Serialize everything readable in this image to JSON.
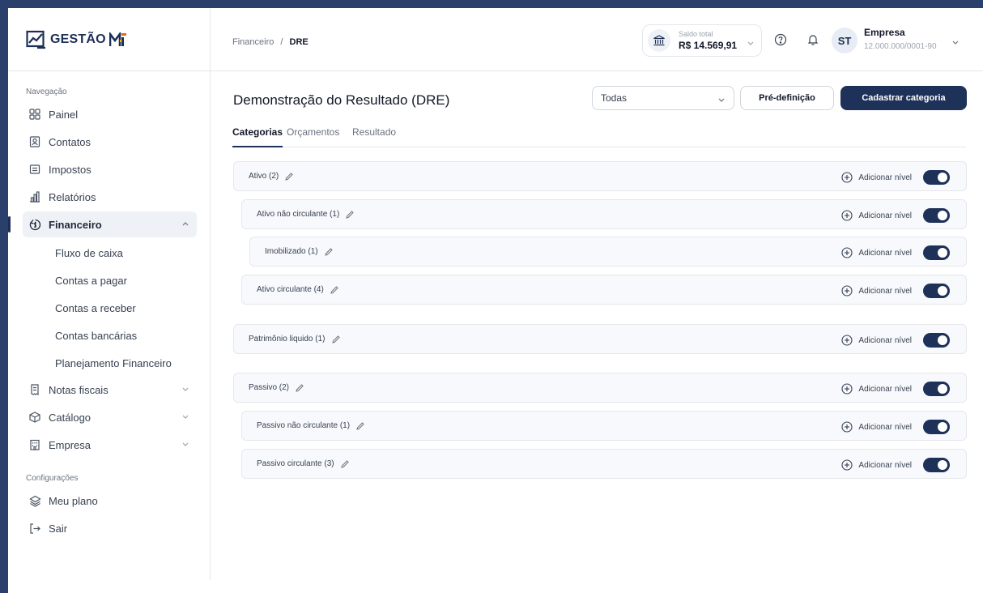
{
  "brand": {
    "name": "GESTÃO",
    "mark": "MEI"
  },
  "sidebar": {
    "nav_section_label": "Navegação",
    "items": [
      {
        "label": "Painel",
        "icon": "grid-icon"
      },
      {
        "label": "Contatos",
        "icon": "contact-card-icon"
      },
      {
        "label": "Impostos",
        "icon": "receipt-icon"
      },
      {
        "label": "Relatórios",
        "icon": "bar-chart-icon"
      },
      {
        "label": "Financeiro",
        "icon": "finance-icon",
        "active": true,
        "expanded": true
      },
      {
        "label": "Notas fiscais",
        "icon": "invoice-icon"
      },
      {
        "label": "Catálogo",
        "icon": "box-icon"
      },
      {
        "label": "Empresa",
        "icon": "building-icon"
      }
    ],
    "financeiro_sub": [
      "Fluxo de caixa",
      "Contas a pagar",
      "Contas a receber",
      "Contas bancárias",
      "Planejamento Financeiro"
    ],
    "config_label": "Configurações",
    "config_items": [
      {
        "label": "Meu plano",
        "icon": "layers-icon"
      },
      {
        "label": "Sair",
        "icon": "logout-icon"
      }
    ]
  },
  "header": {
    "breadcrumb": {
      "parent": "Financeiro",
      "separator": "/",
      "current": "DRE"
    },
    "balance": {
      "label": "Saldo total",
      "value": "R$ 14.569,91"
    },
    "avatar_initials": "ST",
    "company": {
      "name": "Empresa",
      "doc": "12.000.000/0001-90"
    }
  },
  "main": {
    "title": "Demonstração do Resultado (DRE)",
    "filter_value": "Todas",
    "predef_label": "Pré-definição",
    "primary_label": "Cadastrar categoria",
    "tabs": [
      "Categorias",
      "Orçamentos",
      "Resultado"
    ],
    "active_tab": "Categorias",
    "add_level_label": "Adicionar nível",
    "rows": [
      {
        "label": "Ativo (2)",
        "level": 0,
        "enabled": true
      },
      {
        "label": "Ativo não circulante (1)",
        "level": 1,
        "enabled": true
      },
      {
        "label": "Imobilizado (1)",
        "level": 2,
        "enabled": true
      },
      {
        "label": "Ativo circulante (4)",
        "level": 1,
        "enabled": true
      },
      {
        "label": "Patrimônio liquido (1)",
        "level": 0,
        "enabled": true
      },
      {
        "label": "Passivo (2)",
        "level": 0,
        "enabled": true
      },
      {
        "label": "Passivo não circulante (1)",
        "level": 1,
        "enabled": true
      },
      {
        "label": "Passivo circulante (3)",
        "level": 1,
        "enabled": true
      }
    ]
  },
  "colors": {
    "primary": "#1e3158",
    "frame": "#2b3f6c",
    "row_bg": "#f7f9fc",
    "brand_accent": "#e8661c"
  }
}
